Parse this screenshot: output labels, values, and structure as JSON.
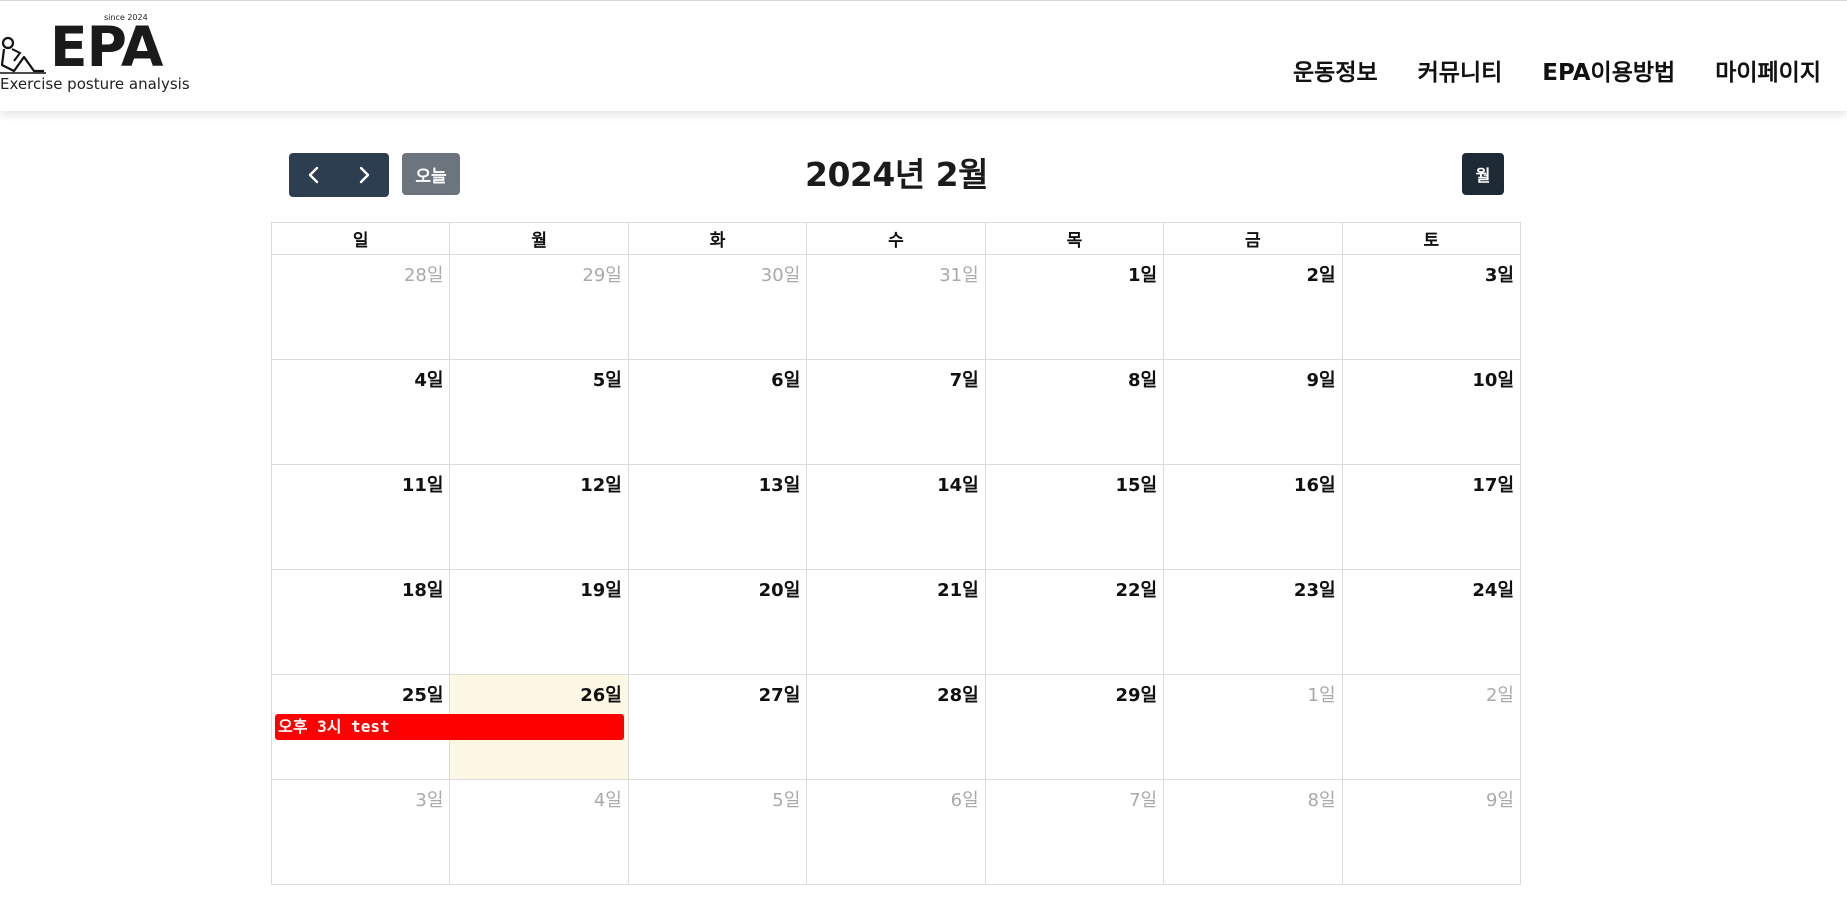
{
  "header": {
    "logo_since": "since 2024",
    "logo_text": "EPA",
    "logo_subtitle": "Exercise posture analysis",
    "nav": [
      "운동정보",
      "커뮤니티",
      "EPA이용방법",
      "마이페이지"
    ]
  },
  "toolbar": {
    "today_label": "오늘",
    "title": "2024년 2월",
    "month_label": "월"
  },
  "weekdays": [
    "일",
    "월",
    "화",
    "수",
    "목",
    "금",
    "토"
  ],
  "weeks": [
    [
      {
        "label": "28일",
        "other": true
      },
      {
        "label": "29일",
        "other": true
      },
      {
        "label": "30일",
        "other": true
      },
      {
        "label": "31일",
        "other": true
      },
      {
        "label": "1일"
      },
      {
        "label": "2일"
      },
      {
        "label": "3일"
      }
    ],
    [
      {
        "label": "4일"
      },
      {
        "label": "5일"
      },
      {
        "label": "6일"
      },
      {
        "label": "7일"
      },
      {
        "label": "8일"
      },
      {
        "label": "9일"
      },
      {
        "label": "10일"
      }
    ],
    [
      {
        "label": "11일"
      },
      {
        "label": "12일"
      },
      {
        "label": "13일"
      },
      {
        "label": "14일"
      },
      {
        "label": "15일"
      },
      {
        "label": "16일"
      },
      {
        "label": "17일"
      }
    ],
    [
      {
        "label": "18일"
      },
      {
        "label": "19일"
      },
      {
        "label": "20일"
      },
      {
        "label": "21일"
      },
      {
        "label": "22일"
      },
      {
        "label": "23일"
      },
      {
        "label": "24일"
      }
    ],
    [
      {
        "label": "25일",
        "event": "오후 3시 test"
      },
      {
        "label": "26일",
        "today": true
      },
      {
        "label": "27일"
      },
      {
        "label": "28일"
      },
      {
        "label": "29일"
      },
      {
        "label": "1일",
        "other": true
      },
      {
        "label": "2일",
        "other": true
      }
    ],
    [
      {
        "label": "3일",
        "other": true
      },
      {
        "label": "4일",
        "other": true
      },
      {
        "label": "5일",
        "other": true
      },
      {
        "label": "6일",
        "other": true
      },
      {
        "label": "7일",
        "other": true
      },
      {
        "label": "8일",
        "other": true
      },
      {
        "label": "9일",
        "other": true
      }
    ]
  ],
  "colors": {
    "event": "#ff0000",
    "today_bg": "#fcf8e3",
    "nav_button": "#2c3e50",
    "today_button": "#6c757d",
    "month_button": "#1e2b37"
  },
  "icons": {
    "prev": "chevron-left-icon",
    "next": "chevron-right-icon",
    "logo": "sit-up-figure-icon"
  }
}
